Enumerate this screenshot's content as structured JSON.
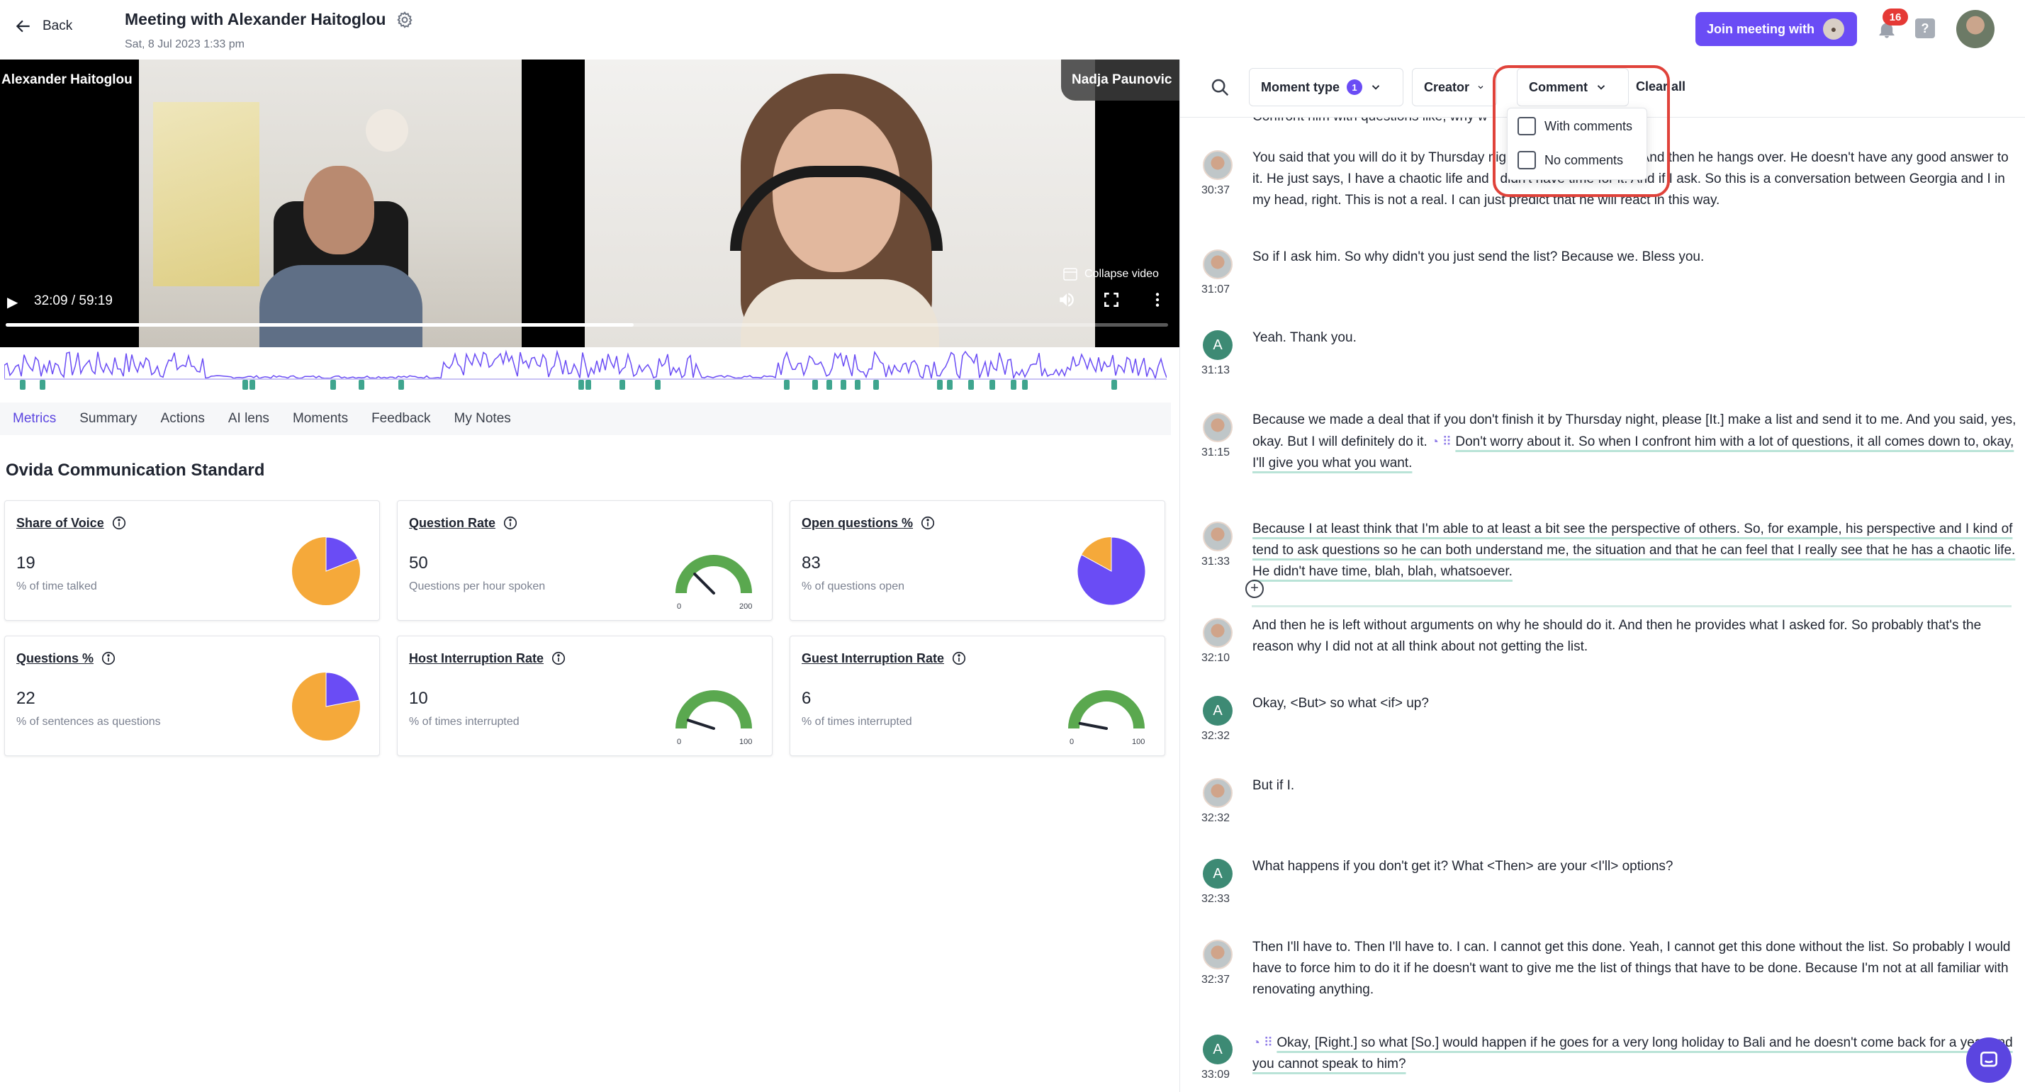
{
  "header": {
    "back_label": "Back",
    "title": "Meeting with Alexander Haitoglou",
    "date": "Sat, 8 Jul 2023 1:33 pm",
    "join_label": "Join meeting with",
    "notification_count": "16",
    "help_label": "?"
  },
  "video": {
    "left_name": "Alexander Haitoglou",
    "right_name": "Nadja Paunovic",
    "collapse_label": "Collapse video",
    "time": "32:09 / 59:19",
    "progress_fraction": 0.54
  },
  "tabs": [
    "Metrics",
    "Summary",
    "Actions",
    "AI lens",
    "Moments",
    "Feedback",
    "My Notes"
  ],
  "section_title": "Ovida Communication Standard",
  "metrics": [
    {
      "title": "Share of Voice",
      "value": "19",
      "subtitle": "% of time talked",
      "kind": "pie",
      "fraction": 0.19
    },
    {
      "title": "Question Rate",
      "value": "50",
      "subtitle": "Questions per hour spoken",
      "kind": "gauge",
      "fraction": 0.25,
      "min": "0",
      "max": "200"
    },
    {
      "title": "Open questions %",
      "value": "83",
      "subtitle": "% of questions open",
      "kind": "pie",
      "fraction": 0.83
    },
    {
      "title": "Questions %",
      "value": "22",
      "subtitle": "% of sentences as questions",
      "kind": "pie",
      "fraction": 0.22
    },
    {
      "title": "Host Interruption Rate",
      "value": "10",
      "subtitle": "% of times interrupted",
      "kind": "gauge",
      "fraction": 0.1,
      "min": "0",
      "max": "100"
    },
    {
      "title": "Guest Interruption Rate",
      "value": "6",
      "subtitle": "% of times interrupted",
      "kind": "gauge",
      "fraction": 0.06,
      "min": "0",
      "max": "100"
    }
  ],
  "filters": {
    "moment_type": "Moment type",
    "moment_count": "1",
    "creator": "Creator",
    "comment": "Comment",
    "clear_all": "Clear all",
    "options": [
      "With comments",
      "No comments"
    ]
  },
  "transcript": {
    "partial_line": "Confront him with questions like, why w",
    "entries": [
      {
        "speaker": "photo",
        "time": "30:37",
        "text": "You said that you will do it by Thursday night, but you didn't do it. And then he hangs over. He doesn't have any good answer to it. He just says, I have a chaotic life and I didn't have time for it. And if I ask. So this is a conversation between Georgia and I in my head, right. This is not a real. I can just predict that he will react in this way."
      },
      {
        "speaker": "photo",
        "time": "31:07",
        "text": "So if I ask him. So why didn't you just send the list? Because we. Bless you."
      },
      {
        "speaker": "A",
        "time": "31:13",
        "text": "Yeah. Thank you."
      },
      {
        "speaker": "photo",
        "time": "31:15",
        "text": "Because we made a deal that if you don't finish it by Thursday night, please [It.] make a list and send it to me. And you said, yes, okay. But I will definitely do it.",
        "highlight": "Don't worry about it. So when I confront him with a lot of questions, it all comes down to, okay, I'll give you what you want."
      },
      {
        "speaker": "photo",
        "time": "31:33",
        "highlight": "Because I at least think that I'm able to at least a bit see the perspective of others. So, for example, his perspective and I kind of tend to ask questions so he can both understand me, the situation and that he can feel that I really see that he has a chaotic life. He didn't have time, blah, blah, whatsoever."
      },
      {
        "speaker": "photo",
        "time": "32:10",
        "text": "And then he is left without arguments on why he should do it. And then he provides what I asked for. So probably that's the reason why I did not at all think about not getting the list."
      },
      {
        "speaker": "A",
        "time": "32:32",
        "text": "Okay, <But> so what <if> up?"
      },
      {
        "speaker": "photo",
        "time": "32:32",
        "text": "But if I."
      },
      {
        "speaker": "A",
        "time": "32:33",
        "text": "What happens if you don't get it? What <Then> are your <I'll> options?"
      },
      {
        "speaker": "photo",
        "time": "32:37",
        "text": "Then I'll have to. Then I'll have to. I can. I cannot get this done. Yeah, I cannot get this done without the list. So probably I would have to force him to do it if he doesn't want to give me the list of things that have to be done. Because I'm not at all familiar with renovating anything."
      },
      {
        "speaker": "A",
        "time": "33:09",
        "highlight": "Okay, [Right.] so what [So.] would happen if he goes for a very long holiday to Bali and he doesn't come back for a year and you cannot speak to him?"
      }
    ]
  },
  "colors": {
    "accent": "#6a4cf5",
    "pie_primary": "#f5a93a",
    "gauge_green": "#5aa84f",
    "highlight_box": "#e0423a",
    "speaker_a": "#3d8a74"
  }
}
